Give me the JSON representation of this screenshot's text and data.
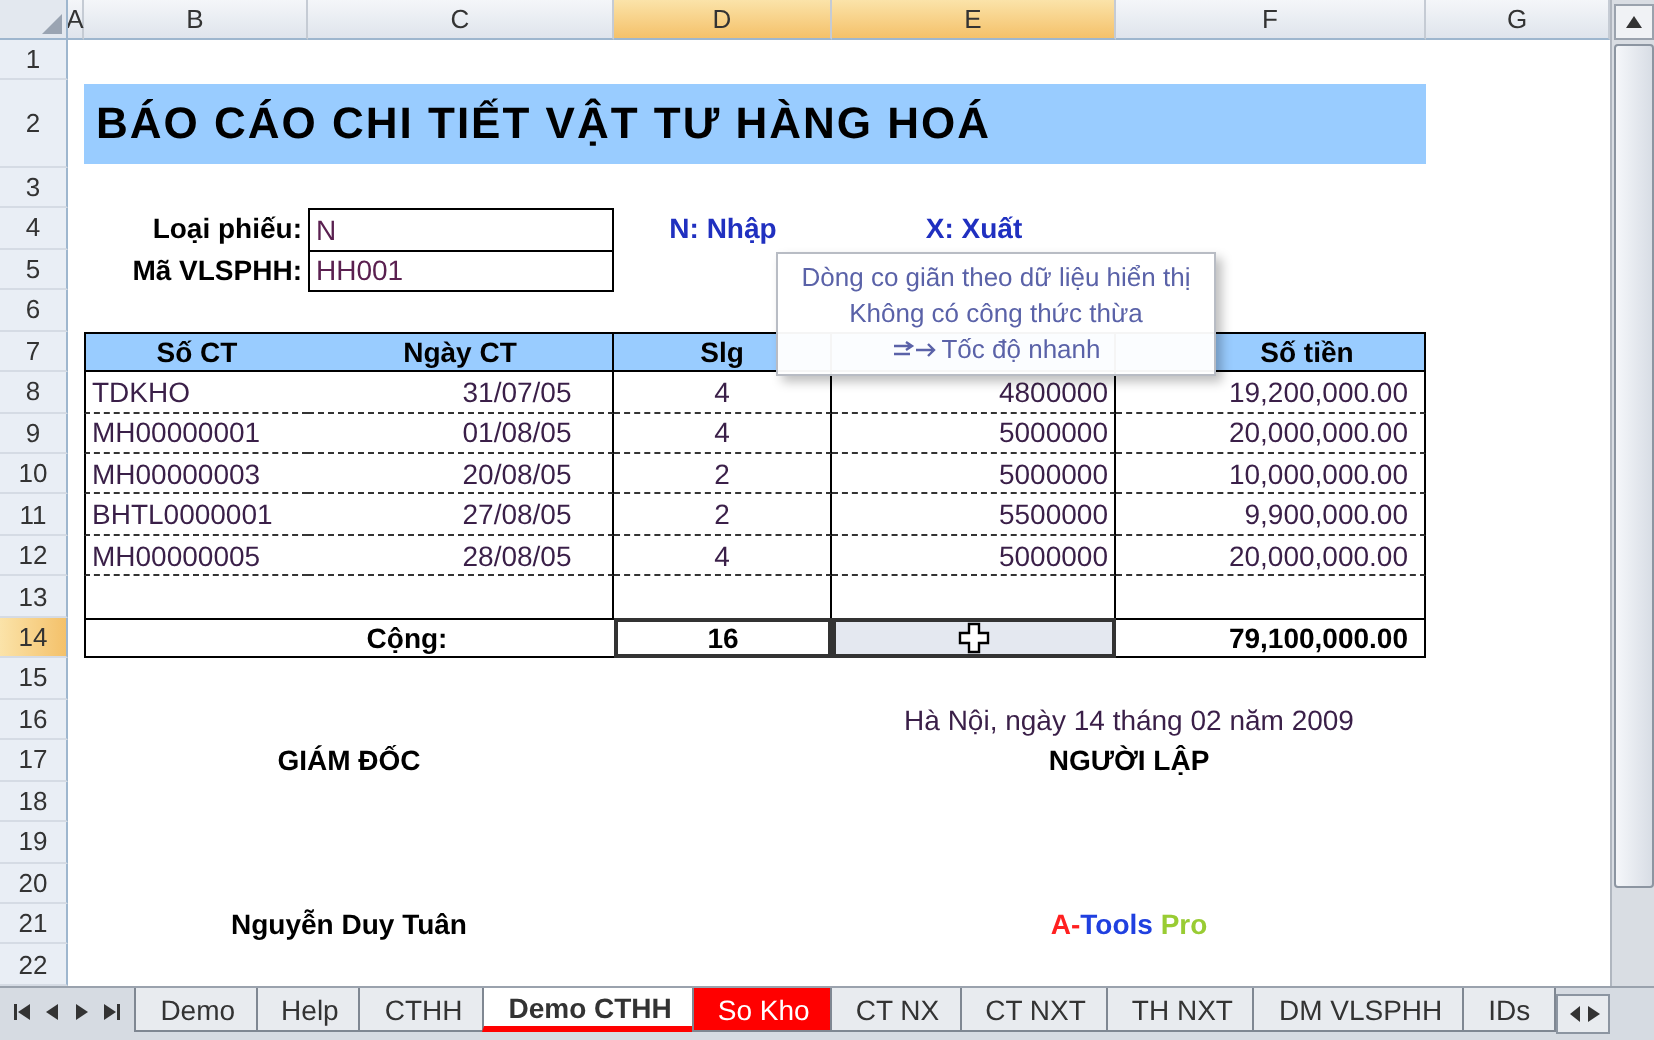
{
  "columns": [
    {
      "label": "A",
      "selected": false
    },
    {
      "label": "B",
      "selected": false
    },
    {
      "label": "C",
      "selected": false
    },
    {
      "label": "D",
      "selected": true
    },
    {
      "label": "E",
      "selected": true
    },
    {
      "label": "F",
      "selected": false
    },
    {
      "label": "G",
      "selected": false
    }
  ],
  "rows": [
    {
      "label": "1",
      "selected": false
    },
    {
      "label": "2",
      "selected": false
    },
    {
      "label": "3",
      "selected": false
    },
    {
      "label": "4",
      "selected": false
    },
    {
      "label": "5",
      "selected": false
    },
    {
      "label": "6",
      "selected": false
    },
    {
      "label": "7",
      "selected": false
    },
    {
      "label": "8",
      "selected": false
    },
    {
      "label": "9",
      "selected": false
    },
    {
      "label": "10",
      "selected": false
    },
    {
      "label": "11",
      "selected": false
    },
    {
      "label": "12",
      "selected": false
    },
    {
      "label": "13",
      "selected": false
    },
    {
      "label": "14",
      "selected": true
    },
    {
      "label": "15",
      "selected": false
    },
    {
      "label": "16",
      "selected": false
    },
    {
      "label": "17",
      "selected": false
    },
    {
      "label": "18",
      "selected": false
    },
    {
      "label": "19",
      "selected": false
    },
    {
      "label": "20",
      "selected": false
    },
    {
      "label": "21",
      "selected": false
    },
    {
      "label": "22",
      "selected": false
    }
  ],
  "report": {
    "title": "BÁO CÁO CHI TIẾT VẬT TƯ HÀNG HOÁ",
    "fields": [
      {
        "label": "Loại phiếu:",
        "value": "N"
      },
      {
        "label": "Mã VLSPHH:",
        "value": "HH001"
      }
    ],
    "legend": [
      "N: Nhập",
      "X: Xuất"
    ],
    "table": {
      "headers": [
        "Số CT",
        "Ngày CT",
        "Slg",
        "Số tiền"
      ],
      "rows": [
        {
          "so_ct": "TDKHO",
          "ngay_ct": "31/07/05",
          "slg": "4",
          "don_gia": "4800000",
          "so_tien": "19,200,000.00"
        },
        {
          "so_ct": "MH00000001",
          "ngay_ct": "01/08/05",
          "slg": "4",
          "don_gia": "5000000",
          "so_tien": "20,000,000.00"
        },
        {
          "so_ct": "MH00000003",
          "ngay_ct": "20/08/05",
          "slg": "2",
          "don_gia": "5000000",
          "so_tien": "10,000,000.00"
        },
        {
          "so_ct": "BHTL0000001",
          "ngay_ct": "27/08/05",
          "slg": "2",
          "don_gia": "5500000",
          "so_tien": "9,900,000.00"
        },
        {
          "so_ct": "MH00000005",
          "ngay_ct": "28/08/05",
          "slg": "4",
          "don_gia": "5000000",
          "so_tien": "20,000,000.00"
        }
      ],
      "total": {
        "label": "Cộng:",
        "slg": "16",
        "so_tien": "79,100,000.00"
      }
    },
    "place_date": "Hà Nội, ngày 14 tháng 02 năm 2009",
    "signers": [
      {
        "role": "GIÁM ĐỐC",
        "name": [
          {
            "text": "Nguyễn Duy Tuân",
            "color": "#000000"
          }
        ]
      },
      {
        "role": "NGƯỜI LẬP",
        "name": [
          {
            "text": "A-",
            "color": "#ff2020"
          },
          {
            "text": "Tools",
            "color": "#2040e0"
          },
          {
            "text": "Pro",
            "color": "#99cc33"
          }
        ]
      }
    ]
  },
  "tooltip": {
    "lines": [
      "Dòng co giãn theo dữ liệu hiển thị",
      "Không có công thức thừa",
      "Tốc độ nhanh"
    ]
  },
  "sheet_tabs": [
    {
      "label": "Demo",
      "selected": false
    },
    {
      "label": "Help",
      "selected": false
    },
    {
      "label": "CTHH",
      "selected": false
    },
    {
      "label": "Demo CTHH",
      "selected": true,
      "color": "#ff0000"
    },
    {
      "label": "So Kho",
      "selected": false,
      "color": "#ff0000"
    },
    {
      "label": "CT NX",
      "selected": false
    },
    {
      "label": "CT NXT",
      "selected": false
    },
    {
      "label": "TH NXT",
      "selected": false
    },
    {
      "label": "DM VLSPHH",
      "selected": false
    },
    {
      "label": "IDs",
      "selected": false
    }
  ]
}
